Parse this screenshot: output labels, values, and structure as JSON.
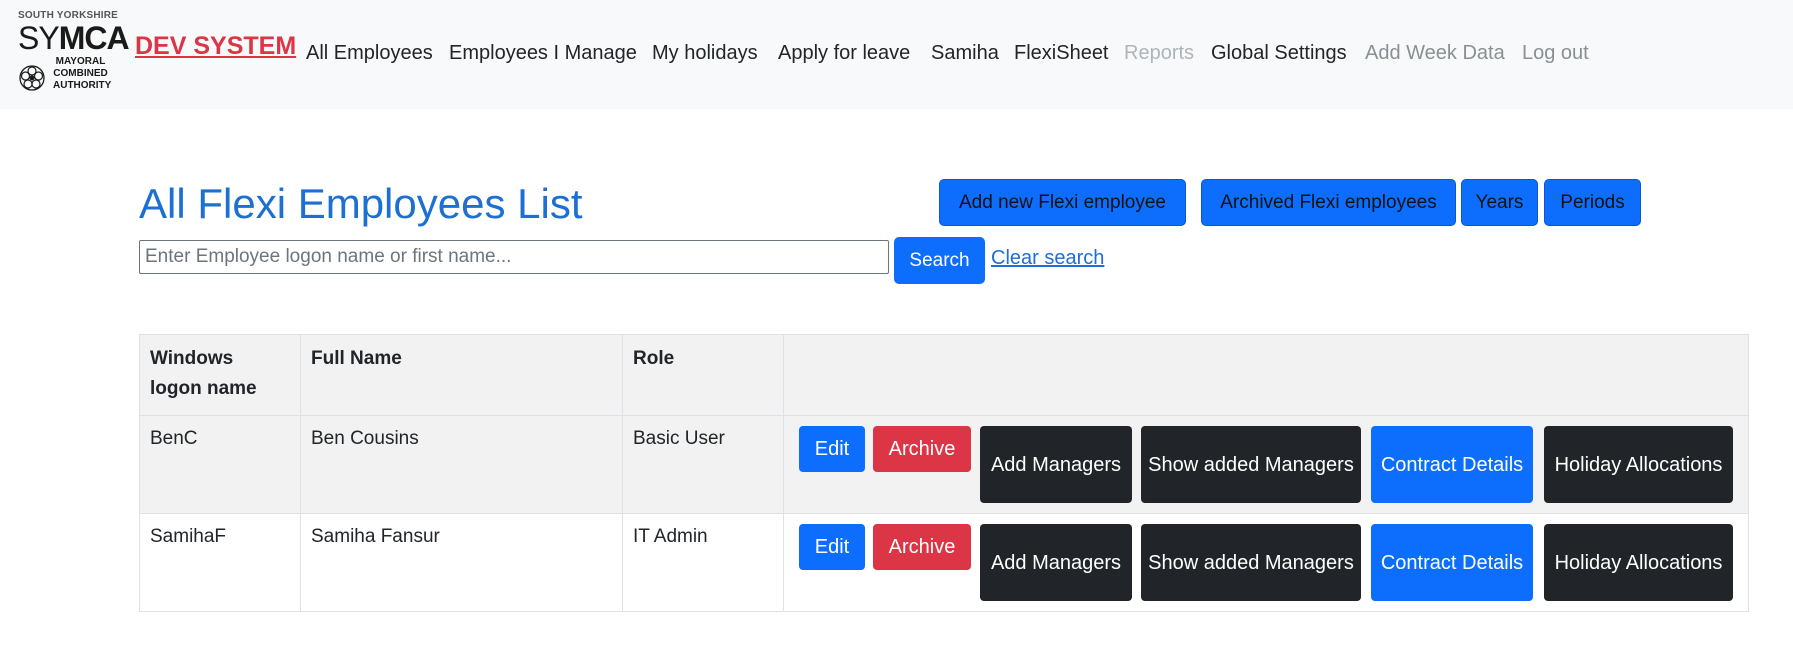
{
  "logo": {
    "line1": "SOUTH YORKSHIRE",
    "line2_a": "SY",
    "line2_b": "MCA",
    "line3": "MAYORAL\nCOMBINED\nAUTHORITY"
  },
  "navbar": {
    "brand": "DEV SYSTEM",
    "links": [
      {
        "label": "All Employees"
      },
      {
        "label": "Employees I Manage"
      },
      {
        "label": "My holidays"
      },
      {
        "label": "Apply for leave"
      },
      {
        "label": "Samiha"
      },
      {
        "label": "FlexiSheet"
      },
      {
        "label": "Reports"
      },
      {
        "label": "Global Settings"
      },
      {
        "label": "Add Week Data"
      },
      {
        "label": "Log out"
      }
    ]
  },
  "main": {
    "title": "All Flexi Employees List",
    "buttons": {
      "add_new": "Add new Flexi employee",
      "archived": "Archived Flexi employees",
      "years": "Years",
      "periods": "Periods"
    },
    "search": {
      "placeholder": "Enter Employee logon name or first name...",
      "value": "",
      "button": "Search",
      "clear": "Clear search"
    }
  },
  "table": {
    "headers": [
      "Windows logon name",
      "Full Name",
      "Role",
      ""
    ],
    "rows": [
      {
        "logon": "BenC",
        "name": "Ben Cousins",
        "role": "Basic User"
      },
      {
        "logon": "SamihaF",
        "name": "Samiha Fansur",
        "role": "IT Admin"
      }
    ],
    "actions": {
      "edit": "Edit",
      "archive": "Archive",
      "add_managers": "Add Managers",
      "show_managers": "Show added Managers",
      "contract": "Contract Details",
      "holiday": "Holiday Allocations"
    }
  },
  "colors": {
    "primary": "#0d6efd",
    "danger": "#dc3545",
    "dark": "#212529",
    "title": "#1c6fd3"
  }
}
